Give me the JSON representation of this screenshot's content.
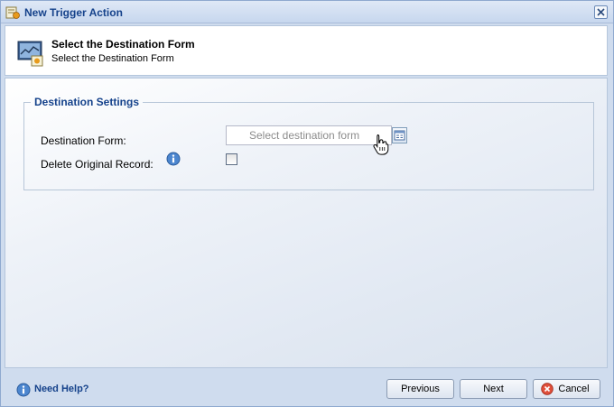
{
  "window": {
    "title": "New Trigger Action",
    "icons": {
      "title": "trigger-action-icon",
      "close": "close-icon"
    }
  },
  "header": {
    "title": "Select the Destination Form",
    "subtitle": "Select the Destination Form",
    "icon": "form-monitor-icon"
  },
  "settings": {
    "legend": "Destination Settings",
    "destination_label": "Destination Form:",
    "destination_placeholder": "Select destination form",
    "destination_value": "",
    "delete_label": "Delete Original Record:",
    "delete_checked": false
  },
  "footer": {
    "help": "Need Help?",
    "previous": "Previous",
    "next": "Next",
    "cancel": "Cancel"
  },
  "colors": {
    "accent": "#15428b",
    "window_bg": "#cfdcee",
    "border": "#8fa9cf"
  }
}
